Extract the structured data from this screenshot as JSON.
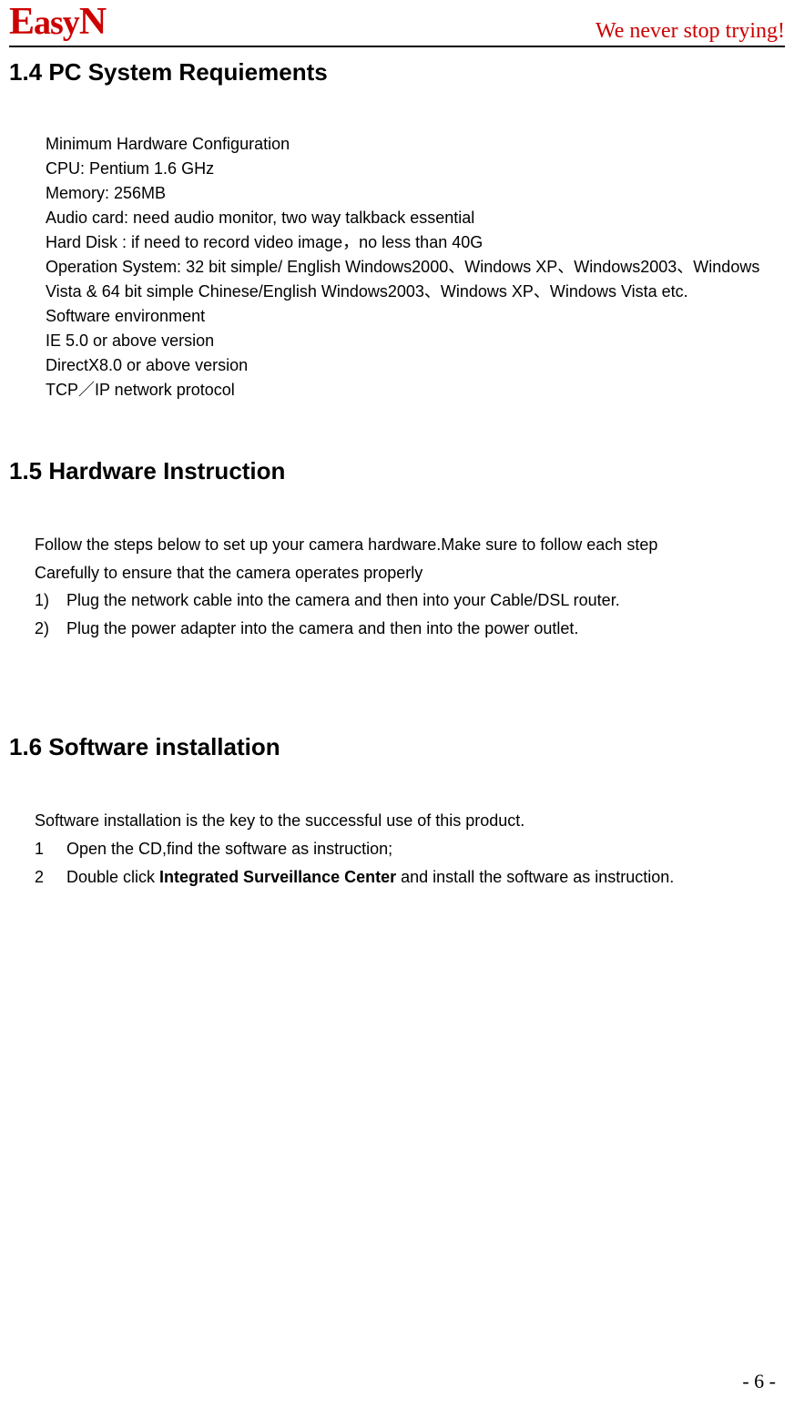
{
  "header": {
    "logo_text": "EasyN",
    "tagline": "We never stop trying!"
  },
  "section_1_4": {
    "heading": "1.4 PC System Requiements",
    "lines": [
      "Minimum Hardware Configuration",
      "CPU:    Pentium 1.6 GHz",
      "Memory:    256MB",
      "Audio card:    need audio monitor, two way talkback essential",
      "Hard Disk :    if need to record video image，no less than 40G",
      "Operation System:    32 bit simple/ English Windows2000、Windows XP、Windows2003、Windows Vista & 64 bit simple Chinese/English Windows2003、Windows XP、Windows Vista etc.",
      "Software environment",
      "IE 5.0 or above version",
      "DirectX8.0 or above version",
      "TCP／IP network protocol"
    ]
  },
  "section_1_5": {
    "heading": "1.5 Hardware Instruction",
    "intro": [
      "Follow the steps below to set up your camera hardware.Make sure to follow each step",
      "Carefully to ensure that the camera operates properly"
    ],
    "steps": [
      {
        "num": "1)",
        "text": "Plug the network cable into the camera and then into your Cable/DSL router."
      },
      {
        "num": "2)",
        "text": "Plug the power adapter into the camera and then into the power outlet."
      }
    ]
  },
  "section_1_6": {
    "heading": "1.6 Software installation",
    "intro": "Software installation is the key to the successful use of this product.",
    "steps": [
      {
        "num": "1",
        "pre": "Open the CD,find the software as instruction;",
        "bold": "",
        "post": ""
      },
      {
        "num": "2",
        "pre": "Double click ",
        "bold": "Integrated Surveillance Center",
        "post": " and install the software as instruction."
      }
    ]
  },
  "page_number": "- 6 -"
}
